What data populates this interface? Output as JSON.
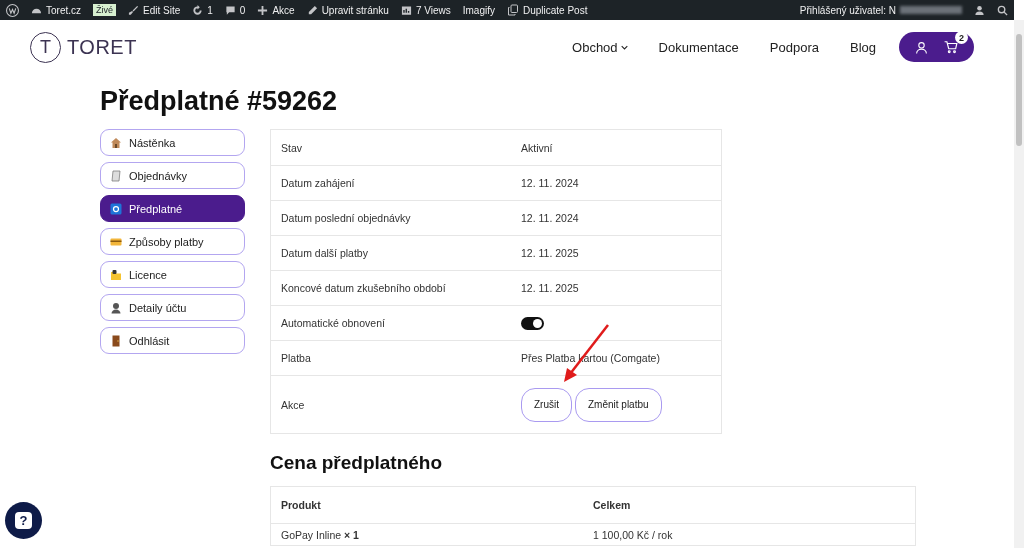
{
  "admin_bar": {
    "items": [
      {
        "kind": "wp"
      },
      {
        "kind": "dashboard",
        "label": "Toret.cz"
      },
      {
        "kind": "badge",
        "label": "Živé"
      },
      {
        "kind": "brush",
        "label": "Edit Site"
      },
      {
        "kind": "refresh",
        "label": "1"
      },
      {
        "kind": "comment",
        "label": "0"
      },
      {
        "kind": "plus",
        "label": "Akce"
      },
      {
        "kind": "pencil",
        "label": "Upravit stránku"
      },
      {
        "kind": "stats",
        "label": "7 Views"
      },
      {
        "kind": "text",
        "label": "Imagify"
      },
      {
        "kind": "copy",
        "label": "Duplicate Post"
      }
    ],
    "user_label": "Přihlášený uživatel: N"
  },
  "header": {
    "logo_letter": "T",
    "logo_text": "TORET",
    "nav": [
      {
        "label": "Obchod",
        "dropdown": true
      },
      {
        "label": "Dokumentace",
        "dropdown": false
      },
      {
        "label": "Podpora",
        "dropdown": false
      },
      {
        "label": "Blog",
        "dropdown": false
      }
    ],
    "cart_count": "2"
  },
  "page_title": "Předplatné #59262",
  "account_nav": [
    {
      "label": "Nástěnka",
      "selected": false
    },
    {
      "label": "Objednávky",
      "selected": false
    },
    {
      "label": "Předplatné",
      "selected": true
    },
    {
      "label": "Způsoby platby",
      "selected": false
    },
    {
      "label": "Licence",
      "selected": false
    },
    {
      "label": "Detaily účtu",
      "selected": false
    },
    {
      "label": "Odhlásit",
      "selected": false
    }
  ],
  "subscription": [
    {
      "kind": "text",
      "label": "Stav",
      "value": "Aktivní"
    },
    {
      "kind": "text",
      "label": "Datum zahájení",
      "value": "12. 11. 2024"
    },
    {
      "kind": "text",
      "label": "Datum poslední objednávky",
      "value": "12. 11. 2024"
    },
    {
      "kind": "text",
      "label": "Datum další platby",
      "value": "12. 11. 2025"
    },
    {
      "kind": "text",
      "label": "Koncové datum zkušebního období",
      "value": "12. 11. 2025"
    },
    {
      "kind": "toggle",
      "label": "Automatické obnovení",
      "on": true
    },
    {
      "kind": "text",
      "label": "Platba",
      "value": "Přes Platba kartou (Comgate)"
    },
    {
      "kind": "buttons",
      "label": "Akce",
      "buttons": [
        "Zrušit",
        "Změnit platbu"
      ]
    }
  ],
  "price_section": {
    "heading": "Cena předplatného",
    "columns": [
      "Produkt",
      "Celkem"
    ],
    "rows": [
      [
        "GoPay Inline **× 1**",
        "1 100,00 Kč / rok"
      ]
    ]
  },
  "help_button": "?"
}
